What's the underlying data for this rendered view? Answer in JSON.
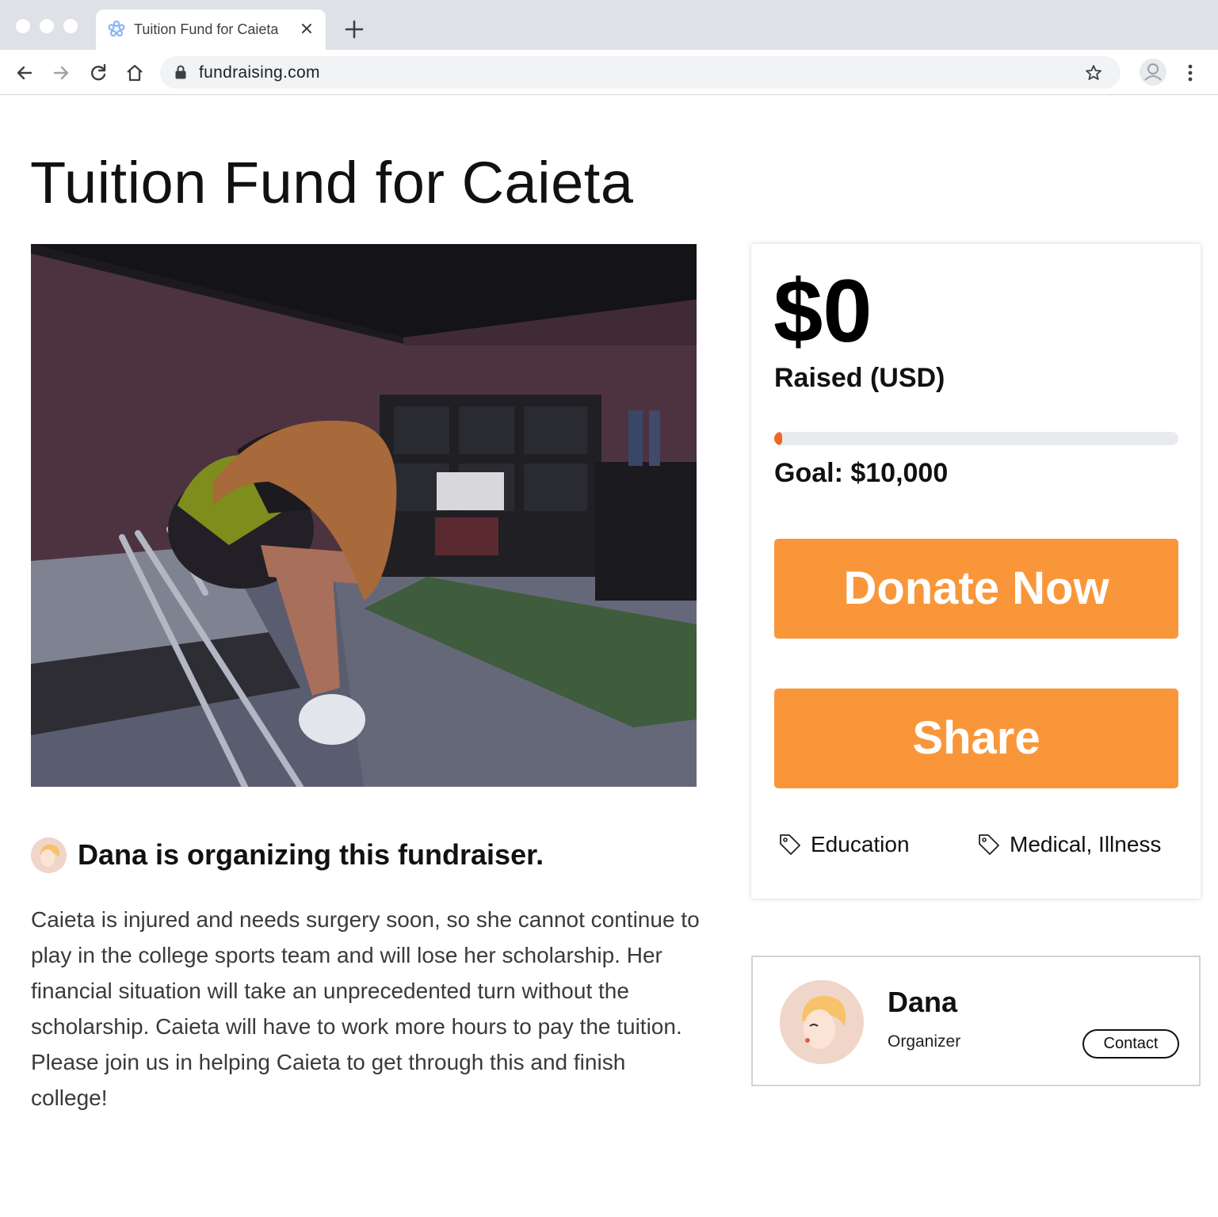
{
  "browser": {
    "tab_title": "Tuition Fund for Caieta",
    "url": "fundraising.com"
  },
  "page": {
    "title": "Tuition Fund for Caieta",
    "hero_image": "hero-illustration-injured-student"
  },
  "donation": {
    "amount": "$0",
    "amount_label": "Raised (USD)",
    "progress_fraction": 0.01,
    "goal": "Goal: $10,000",
    "donate_label": "Donate Now",
    "share_label": "Share",
    "tags": [
      "Education",
      "Medical, Illness"
    ],
    "accent_color": "#fa963a",
    "progress_color": "#f26522"
  },
  "organizer": {
    "headline": "Dana is organizing this fundraiser.",
    "name": "Dana",
    "role": "Organizer",
    "contact_label": "Contact"
  },
  "story": "Caieta is injured and needs surgery soon, so she cannot continue to play in the college sports team and will lose her scholarship. Her financial situation will take an unprecedented turn without the scholarship. Caieta will have to work more hours to pay the tuition. Please join us in helping Caieta to get through this and finish college!"
}
